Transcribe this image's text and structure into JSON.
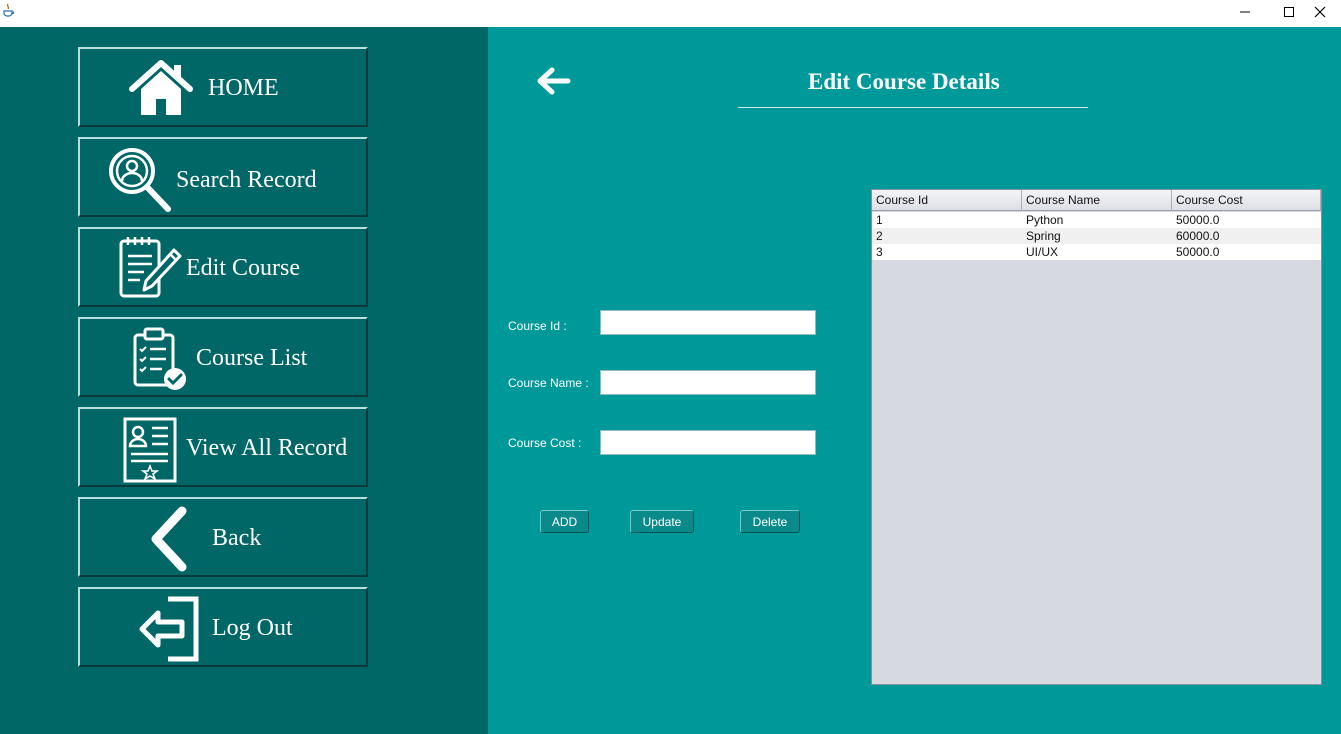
{
  "window": {
    "minimize_glyph": "minimize-icon",
    "maximize_glyph": "maximize-icon",
    "close_glyph": "close-icon"
  },
  "sidebar": {
    "items": [
      {
        "label": "HOME",
        "icon": "home-icon"
      },
      {
        "label": "Search Record",
        "icon": "search-user-icon"
      },
      {
        "label": "Edit Course",
        "icon": "edit-document-icon"
      },
      {
        "label": "Course List",
        "icon": "clipboard-check-icon"
      },
      {
        "label": "View All Record",
        "icon": "certificate-icon"
      },
      {
        "label": "Back",
        "icon": "chevron-left-icon"
      },
      {
        "label": "Log Out",
        "icon": "logout-icon"
      }
    ]
  },
  "main": {
    "title": "Edit Course Details",
    "back_icon": "arrow-left-icon",
    "form": {
      "course_id_label": "Course Id :",
      "course_id_value": "",
      "course_name_label": "Course Name :",
      "course_name_value": "",
      "course_cost_label": "Course Cost :",
      "course_cost_value": ""
    },
    "buttons": {
      "add": "ADD",
      "update": "Update",
      "delete": "Delete"
    },
    "table": {
      "columns": [
        "Course Id",
        "Course Name",
        "Course Cost"
      ],
      "rows": [
        [
          "1",
          "Python",
          "50000.0"
        ],
        [
          "2",
          "Spring",
          "60000.0"
        ],
        [
          "3",
          "UI/UX",
          "50000.0"
        ]
      ]
    }
  },
  "colors": {
    "sidebar_bg": "#006666",
    "main_bg": "#009999",
    "table_bg": "#d6d9e0"
  }
}
